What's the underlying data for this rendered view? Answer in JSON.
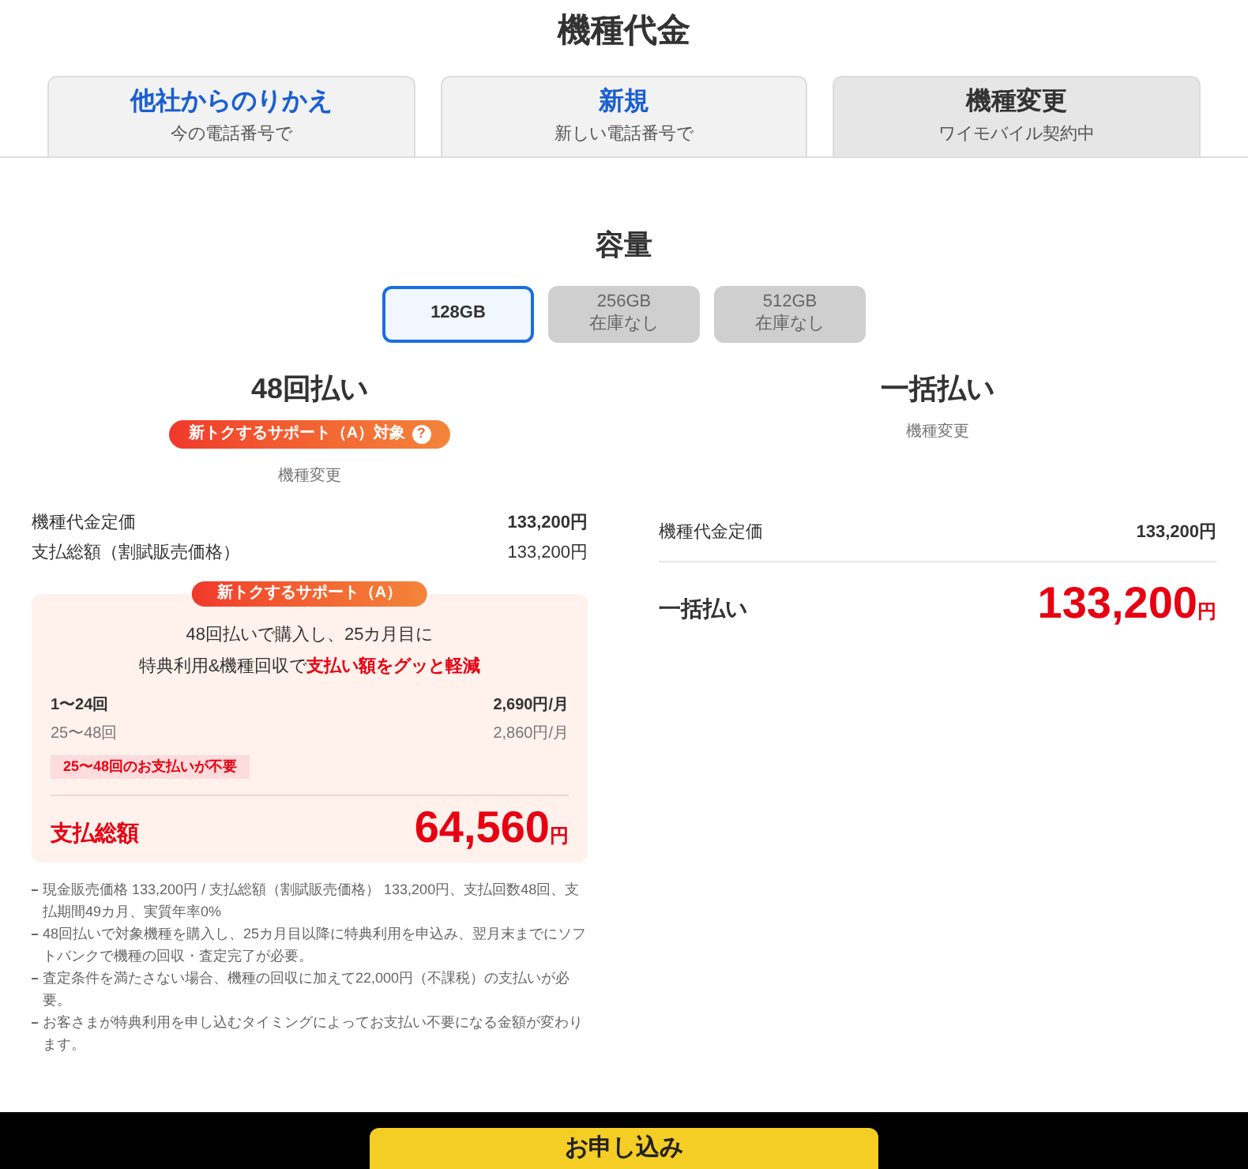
{
  "title": "機種代金",
  "tabs": [
    {
      "label": "他社からのりかえ",
      "sub": "今の電話番号で",
      "selected": false
    },
    {
      "label": "新規",
      "sub": "新しい電話番号で",
      "selected": false
    },
    {
      "label": "機種変更",
      "sub": "ワイモバイル契約中",
      "selected": true
    }
  ],
  "capacity": {
    "title": "容量",
    "options": [
      {
        "label": "128GB",
        "selected": true,
        "disabled": false
      },
      {
        "label": "256GB",
        "stock": "在庫なし",
        "selected": false,
        "disabled": true
      },
      {
        "label": "512GB",
        "stock": "在庫なし",
        "selected": false,
        "disabled": true
      }
    ]
  },
  "installment": {
    "title": "48回払い",
    "badge": "新トクするサポート（A）対象",
    "badge_help": "?",
    "contract": "機種変更",
    "rows": [
      {
        "label": "機種代金定価",
        "value": "133,200円",
        "bold": true
      },
      {
        "label": "支払総額（割賦販売価格）",
        "value": "133,200円",
        "bold": false
      }
    ],
    "support": {
      "tag": "新トクするサポート（A）",
      "text": "48回払いで購入し、25カ月目に",
      "text2": "特典利用&機種回収で**支払い額をグッと軽減**",
      "periods": [
        {
          "label": "1〜24回",
          "value": "2,690円/月",
          "bold": true
        },
        {
          "label": "25〜48回",
          "value": "2,860円/月",
          "bold": false
        }
      ],
      "note": "25〜48回のお支払いが不要",
      "total_label": "支払総額",
      "total": "64,560",
      "unit": "円"
    },
    "notes": [
      "現金販売価格 133,200円 / 支払総額（割賦販売価格） 133,200円、支払回数48回、支払期間49カ月、実質年率0%",
      "48回払いで対象機種を購入し、25カ月目以降に特典利用を申込み、翌月末までにソフトバンクで機種の回収・査定完了が必要。",
      "査定条件を満たさない場合、機種の回収に加えて22,000円（不課税）の支払いが必要。",
      "お客さまが特典利用を申し込むタイミングによってお支払い不要になる金額が変わります。"
    ]
  },
  "lump": {
    "title": "一括払い",
    "contract": "機種変更",
    "rows": [
      {
        "label": "機種代金定価",
        "value": "133,200円"
      }
    ],
    "total_label": "一括払い",
    "total": "133,200",
    "unit": "円"
  },
  "cta": {
    "label": "お申し込み"
  }
}
